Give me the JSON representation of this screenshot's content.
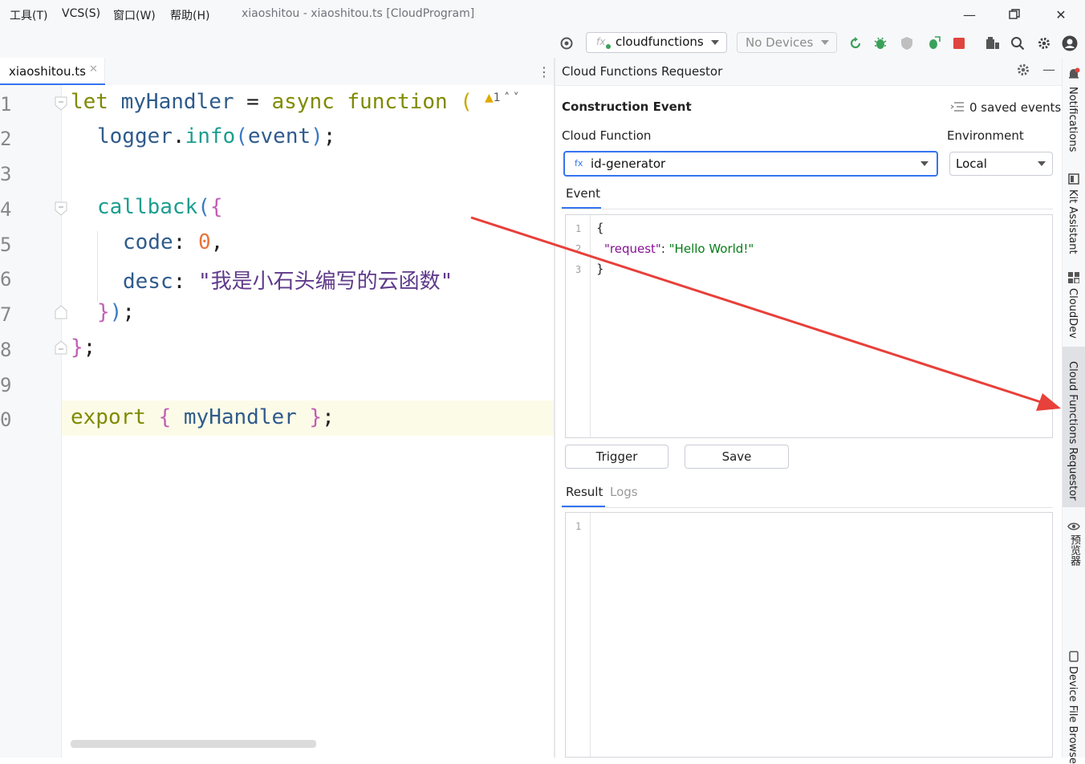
{
  "menu": {
    "items": [
      "工具(T)",
      "VCS(S)",
      "窗口(W)",
      "帮助(H)"
    ],
    "title": "xiaoshitou - xiaoshitou.ts [CloudProgram]"
  },
  "toolbar": {
    "function_combo": "cloudfunctions",
    "devices_combo": "No Devices"
  },
  "editor": {
    "tab_name": "xiaoshitou.ts",
    "warning_count": "1",
    "line_numbers": [
      "1",
      "2",
      "3",
      "4",
      "5",
      "6",
      "7",
      "8",
      "9",
      "0"
    ],
    "code": {
      "l1_let": "let ",
      "l1_name": "myHandler",
      "l1_eq": " = ",
      "l1_async": "async ",
      "l1_function": "function ",
      "l1_rest": "(",
      "l2_logger": "logger",
      "l2_dot": ".",
      "l2_info": "info",
      "l2_paren_open": "(",
      "l2_event": "event",
      "l2_paren_close": ")",
      "l2_semi": ";",
      "l4_callback": "callback",
      "l4_paren": "(",
      "l4_brace": "{",
      "l5_key": "code",
      "l5_colon": ": ",
      "l5_val": "0",
      "l5_comma": ",",
      "l6_key": "desc",
      "l6_colon": ": ",
      "l6_val": "\"我是小石头编写的云函数\"",
      "l7_brace": "}",
      "l7_paren": ")",
      "l7_semi": ";",
      "l8_brace": "}",
      "l8_semi": ";",
      "l10_export": "export ",
      "l10_brace_open": "{ ",
      "l10_name": "myHandler",
      "l10_brace_close": " }",
      "l10_semi": ";"
    }
  },
  "requestor": {
    "panel_title": "Cloud Functions Requestor",
    "section_title": "Construction Event",
    "saved_events": "0 saved events",
    "cloud_function_label": "Cloud Function",
    "environment_label": "Environment",
    "function_value": "id-generator",
    "fx_badge": "fx",
    "environment_value": "Local",
    "event_tab": "Event",
    "event_lines": [
      "1",
      "2",
      "3"
    ],
    "event_code": {
      "open": "{",
      "key": "\"request\"",
      "colon": ": ",
      "value": "\"Hello World!\"",
      "close": "}"
    },
    "trigger_button": "Trigger",
    "save_button": "Save",
    "result_tab": "Result",
    "logs_tab": "Logs",
    "result_lines": [
      "1"
    ]
  },
  "right_strip": {
    "items": [
      "Notifications",
      "Kit Assistant",
      "CloudDev",
      "Cloud Functions Requestor",
      "预览器",
      "Device File Browse"
    ]
  },
  "colors": {
    "accent": "#3574f0",
    "arrow": "#e8403a",
    "run_green": "#3aa15a",
    "stop_red": "#e0443e"
  }
}
